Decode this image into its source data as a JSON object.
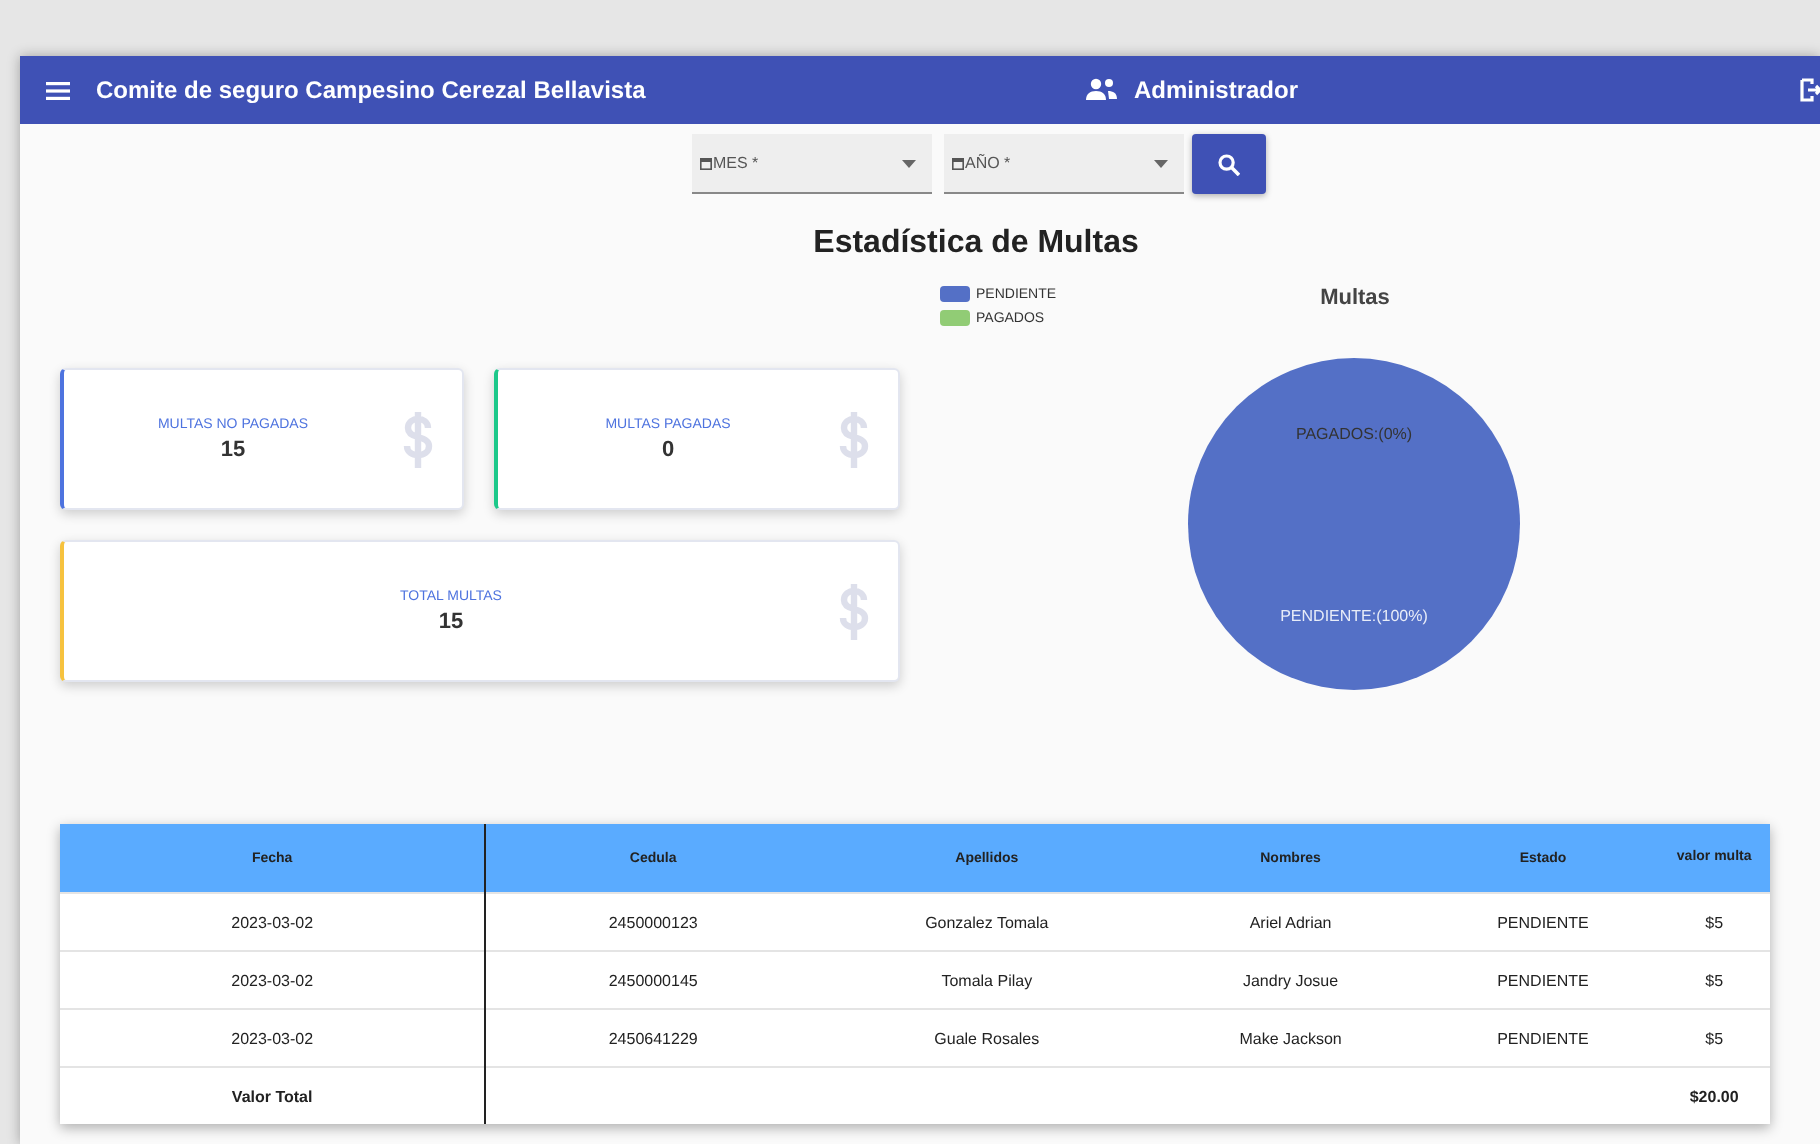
{
  "header": {
    "title": "Comite de seguro Campesino Cerezal Bellavista",
    "user": "Administrador"
  },
  "filters": [
    {
      "label": "MES *"
    },
    {
      "label": "AÑO *"
    }
  ],
  "page_title": "Estadística de Multas",
  "cards": [
    {
      "label": "MULTAS NO PAGADAS",
      "value": "15",
      "color": "#4e73df"
    },
    {
      "label": "MULTAS PAGADAS",
      "value": "0",
      "color": "#1cc88a"
    },
    {
      "label": "TOTAL MULTAS",
      "value": "15",
      "color": "#f6c23e"
    }
  ],
  "legend": [
    {
      "color": "#5470c6"
    },
    {
      "color": "#91cc75"
    }
  ],
  "chart_data": {
    "type": "pie",
    "title": "Multas",
    "categories": [
      "PENDIENTE",
      "PAGADOS"
    ],
    "values": [
      100,
      0
    ],
    "value_labels": [
      "PENDIENTE:(100%)",
      "PAGADOS:(0%)"
    ]
  },
  "table": {
    "columns": [
      "Fecha",
      "Cedula",
      "Apellidos",
      "Nombres",
      "Estado",
      "valor multa"
    ],
    "rows": [
      [
        "2023-03-02",
        "2450000123",
        "Gonzalez Tomala",
        "Ariel Adrian",
        "PENDIENTE",
        "$5"
      ],
      [
        "2023-03-02",
        "2450000145",
        "Tomala Pilay",
        "Jandry Josue",
        "PENDIENTE",
        "$5"
      ],
      [
        "2023-03-02",
        "2450641229",
        "Guale Rosales",
        "Make Jackson",
        "PENDIENTE",
        "$5"
      ]
    ],
    "total_label": "Valor Total",
    "total_value": "$20.00"
  }
}
